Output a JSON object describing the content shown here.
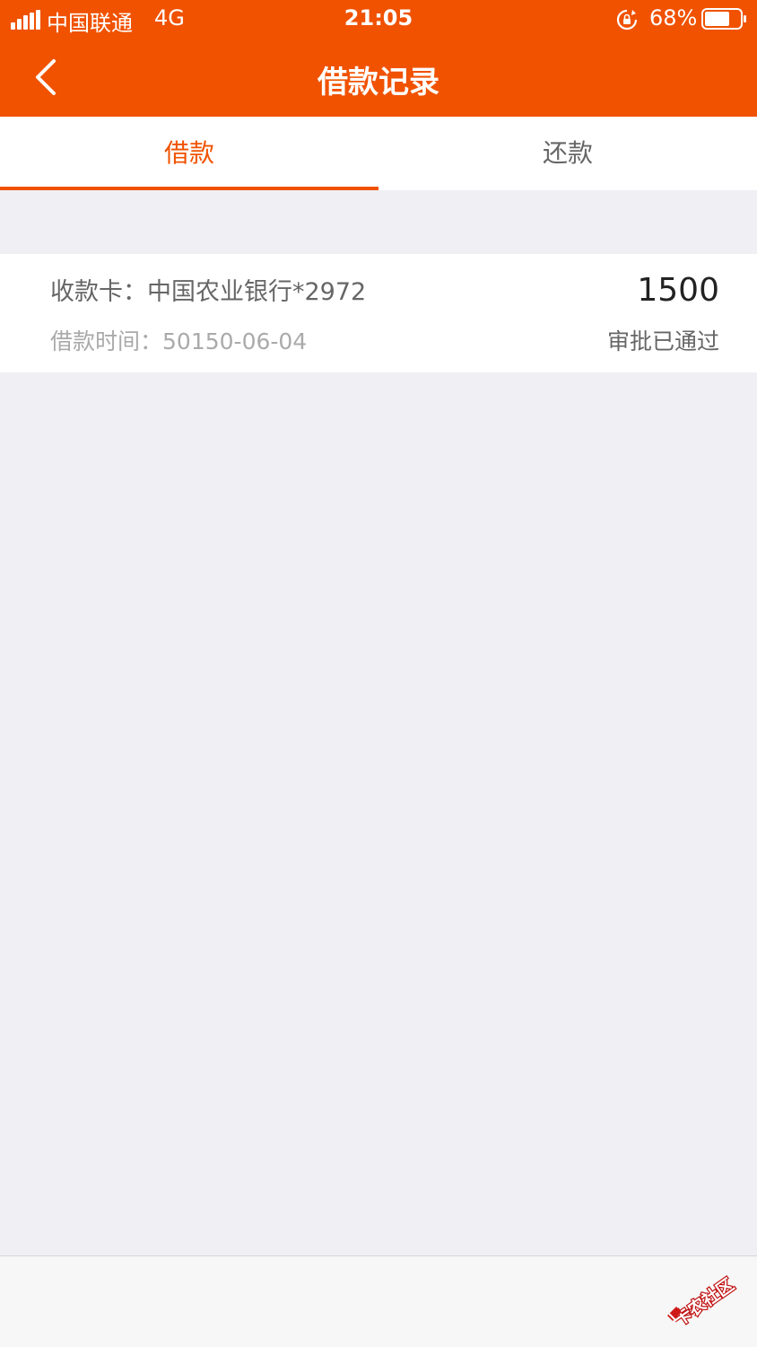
{
  "status_bar": {
    "carrier": "中国联通",
    "network": "4G",
    "time": "21:05",
    "battery_percent": "68%"
  },
  "nav": {
    "title": "借款记录"
  },
  "tabs": [
    {
      "label": "借款",
      "active": true
    },
    {
      "label": "还款",
      "active": false
    }
  ],
  "records": [
    {
      "card_label": "收款卡：",
      "card_value": "中国农业银行*2972",
      "time_label": "借款时间：",
      "time_value": "50150-06-04",
      "amount": "1500",
      "status": "审批已通过"
    }
  ],
  "watermark": {
    "text": "卡农社区"
  },
  "colors": {
    "brand": "#f05200",
    "background": "#efeff4"
  },
  "icons": {
    "back": "chevron-left-icon",
    "signal": "signal-icon",
    "rotation_lock": "rotation-lock-icon",
    "battery": "battery-icon"
  }
}
